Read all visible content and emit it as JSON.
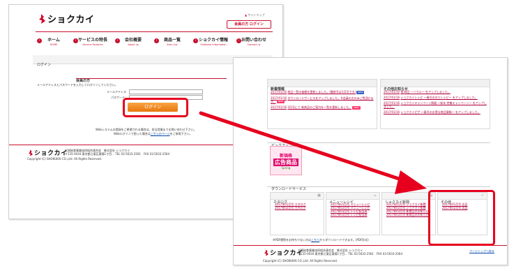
{
  "login_page": {
    "logo_text": "ショクカイ",
    "utility": "サイトマップ",
    "top_button": "会員の方 ログイン",
    "nav": [
      {
        "jp": "ホーム",
        "en": "HOME"
      },
      {
        "jp": "サービスの特長",
        "en": "Service Features"
      },
      {
        "jp": "会社概要",
        "en": "About us"
      },
      {
        "jp": "商品一覧",
        "en": "Item List"
      },
      {
        "jp": "ショクカイ情報",
        "en": "Shokukai Information"
      },
      {
        "jp": "お問い合わせ",
        "en": "Contact us"
      }
    ],
    "breadcrumb": "ログイン",
    "members_heading": "会員の方",
    "instruction": "メールアドレスとパスワードを入力してログインしてください。",
    "email_label": "メールアドレス",
    "password_label": "パスワード",
    "login_button": "ログイン",
    "notice_1": "Webシステムの登録をご希望される場合は、担当営業までお問い合わせ下さい。",
    "notice_2": "Webログインで困った場合は",
    "notice_link": "こちらのページ",
    "notice_2b": "をご参照下さい。",
    "footer_company": "全国給食事業協同組合連合会　株式会社 ショクカイ",
    "footer_address": "〒135-0016 東京都江東区東陽1丁目... TEL 03-5633-2561　FAX 03-5633-2564",
    "copyright": "Copyright (C) SHOKUKAI CO.,Ltd. All Rights Reserved."
  },
  "member_page": {
    "news": {
      "title": "新着情報",
      "items": [
        {
          "date": "2017/01/16",
          "text": "商品一覧の価格を更新しました。(最新号は1月号です)",
          "badge": "NEW"
        },
        {
          "date": "2017/01/16",
          "text": "ダウンロードサービスをアップしました。※会員の方のみご覧頂けます。",
          "badge": "NEW"
        },
        {
          "date": "2017/01/16",
          "text": "3月号にて 新商品のご案内を一覧を更新しました。",
          "badge": "NEW"
        }
      ]
    },
    "recommend": {
      "title": "その他お知らせ",
      "items": [
        {
          "date": "2017/01/16",
          "text": "第36回 ～ソウル～ をアップしました。"
        },
        {
          "date": "2017/01/16",
          "text": "ショクカイレシピ ～春号ののりレシピ～ をアップしました。"
        },
        {
          "date": "2017/01/16",
          "text": "ショクカイキャンペーン情報 ～新年 特集キャンペーン～ をアップしました。"
        },
        {
          "date": "2017/01/16",
          "text": "ショクカイピザ ～春号のお得な商品情報～ をアップしました。"
        }
      ]
    },
    "pickup": {
      "title": "ピックアップ商品",
      "banner_lines": [
        "新価格",
        "広告商品",
        "Spring"
      ]
    },
    "download": {
      "title": "ダウンロードサービス",
      "columns": [
        {
          "title": "カタログ",
          "links": [
            "2017年01月号 カタログ",
            "2017年02月号 カタログ"
          ]
        },
        {
          "title": "メニューレシピ",
          "links": [
            "2017年01月号 メニューレシピ",
            "2017年02月号 メニューレシピ",
            "2017年03月号 レシピ配当表",
            "2017年03月号 レシピ配当表"
          ]
        },
        {
          "title": "ショクカイ新聞",
          "links": [
            "2017年01月号 ショクカイ新聞",
            "2017年02月号 ショクカイ新聞",
            "2017年03月号 新商品のお知らせ",
            "2017年03月号 新商品のお知らせ"
          ]
        },
        {
          "title": "その他",
          "links": [
            "2017年01月号 広告",
            "2017年02月号 広告"
          ]
        }
      ],
      "note_prefix": "※PDF閲覧をお持ちでない方は",
      "note_link": "こちら",
      "note_suffix": "からダウンロードできます。(PDF形式)"
    },
    "footer_company": "全国給食事業協同組合連合会　株式会社 ショクカイ",
    "footer_address": "〒135-0016 東京都江東区東陽1丁目... TEL 03-5633-2561　FAX 03-5633-2564",
    "pagetop": "ページトップへ戻る",
    "copyright": "Copyright (C) SHOKUKAI CO.,Ltd. All Rights Reserved."
  },
  "colors": {
    "brand_red": "#c8102e",
    "highlight": "#e6001e",
    "login_orange": "#f08a1c"
  }
}
